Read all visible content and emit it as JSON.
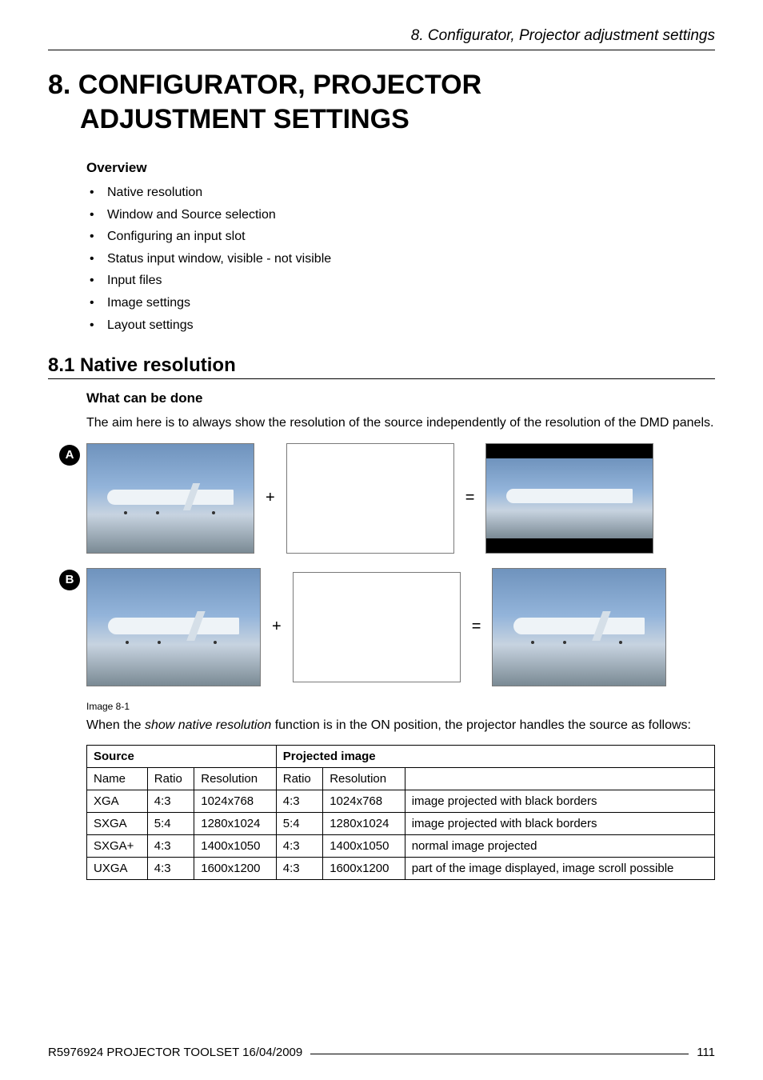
{
  "running_head": "8. Configurator, Projector adjustment settings",
  "chapter_title_line1": "8. CONFIGURATOR, PROJECTOR",
  "chapter_title_line2": "ADJUSTMENT SETTINGS",
  "overview": {
    "heading": "Overview",
    "items": [
      "Native resolution",
      "Window and Source selection",
      "Configuring an input slot",
      "Status input window, visible - not visible",
      "Input files",
      "Image settings",
      "Layout settings"
    ]
  },
  "section": {
    "number_title": "8.1    Native resolution",
    "sub_heading": "What can be done",
    "body": "The aim here is to always show the resolution of the source independently of the resolution of the DMD panels."
  },
  "diagram": {
    "badge_a": "A",
    "badge_b": "B",
    "plus": "+",
    "equals": "=",
    "caption": "Image 8-1"
  },
  "after_diagram": {
    "sentence_pre": "When the ",
    "sentence_em": "show native resolution",
    "sentence_post": " function is in the ON position, the projector handles the source as follows:"
  },
  "chart_data": {
    "type": "table",
    "title": "",
    "group_headers": [
      "Source",
      "Projected image"
    ],
    "sub_headers_source": [
      "Name",
      "Ratio",
      "Resolution"
    ],
    "sub_headers_proj": [
      "Ratio",
      "Resolution",
      ""
    ],
    "rows": [
      {
        "name": "XGA",
        "s_ratio": "4:3",
        "s_res": "1024x768",
        "p_ratio": "4:3",
        "p_res": "1024x768",
        "note": "image projected with black borders"
      },
      {
        "name": "SXGA",
        "s_ratio": "5:4",
        "s_res": "1280x1024",
        "p_ratio": "5:4",
        "p_res": "1280x1024",
        "note": "image projected with black borders"
      },
      {
        "name": "SXGA+",
        "s_ratio": "4:3",
        "s_res": "1400x1050",
        "p_ratio": "4:3",
        "p_res": "1400x1050",
        "note": "normal image projected"
      },
      {
        "name": "UXGA",
        "s_ratio": "4:3",
        "s_res": "1600x1200",
        "p_ratio": "4:3",
        "p_res": "1600x1200",
        "note": "part of the image displayed, image scroll possible"
      }
    ]
  },
  "footer": {
    "left": "R5976924   PROJECTOR TOOLSET   16/04/2009",
    "page": "111"
  }
}
